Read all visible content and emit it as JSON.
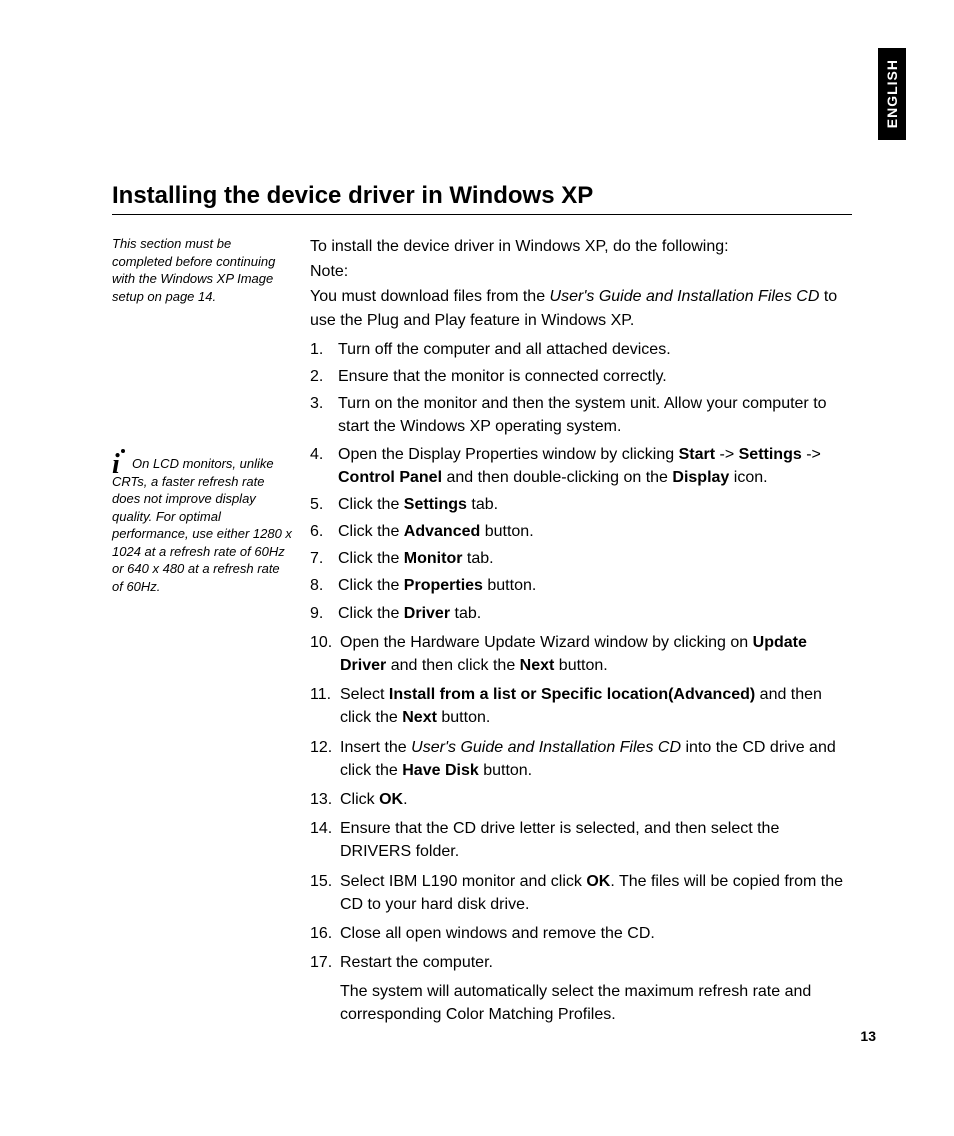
{
  "lang_tab": "ENGLISH",
  "title": "Installing the device driver in Windows XP",
  "margin_note_1": "This section must be completed before continuing with the Windows XP Image setup on page 14.",
  "margin_note_2_line1": "On LCD monitors, unlike",
  "margin_note_2_rest": "CRTs, a faster refresh rate does not improve display quality. For optimal performance, use either 1280 x 1024 at a refresh rate of 60Hz or 640 x 480 at a refresh rate of 60Hz.",
  "intro_line1": "To install the device driver in Windows XP, do the following:",
  "intro_line2": "Note:",
  "intro_line3_pre": "You must download files from the ",
  "intro_line3_cd": "User's Guide and Installation Files CD",
  "intro_line3_post": " to use the Plug and Play feature in Windows XP.",
  "steps": {
    "s1": "Turn off the computer and all attached devices.",
    "s2": "Ensure that the monitor is connected correctly.",
    "s3": "Turn on the monitor and then the system unit. Allow your computer to start the Windows XP operating system.",
    "s4_a": "Open the Display Properties window by clicking ",
    "s4_start": "Start",
    "s4_arrow1": " -> ",
    "s4_settings": "Settings",
    "s4_arrow2": " -> ",
    "s4_cp": "Control Panel",
    "s4_b": " and then double-clicking on the ",
    "s4_display": "Display",
    "s4_c": " icon.",
    "s5_a": "Click the ",
    "s5_b": "Settings",
    "s5_c": " tab.",
    "s6_a": "Click the ",
    "s6_b": "Advanced",
    "s6_c": " button.",
    "s7_a": "Click the ",
    "s7_b": "Monitor",
    "s7_c": " tab.",
    "s8_a": "Click the ",
    "s8_b": "Properties",
    "s8_c": " button.",
    "s9_a": "Click the ",
    "s9_b": "Driver",
    "s9_c": " tab.",
    "s10_a": "Open the Hardware Update Wizard window by clicking on ",
    "s10_b": "Update Driver",
    "s10_c": " and then click the ",
    "s10_d": "Next",
    "s10_e": " button.",
    "s11_a": "Select ",
    "s11_b": "Install from a list or Specific location(Advanced)",
    "s11_c": " and then click the ",
    "s11_d": "Next",
    "s11_e": " button.",
    "s12_a": "Insert the ",
    "s12_cd": "User's Guide and Installation Files CD",
    "s12_b": " into the CD drive and click the ",
    "s12_c": "Have Disk",
    "s12_d": " button.",
    "s13_a": "Click ",
    "s13_b": "OK",
    "s13_c": ".",
    "s14": "Ensure that the CD drive letter is selected, and then select the DRIVERS folder.",
    "s15_a": "Select IBM L190 monitor and click ",
    "s15_b": "OK",
    "s15_c": ". The files will be copied from the CD to your hard disk drive.",
    "s16": "Close all open windows and remove the CD.",
    "s17": "Restart the computer."
  },
  "closing": "The system will automatically select the maximum refresh rate and corresponding Color Matching Profiles.",
  "page_number": "13"
}
